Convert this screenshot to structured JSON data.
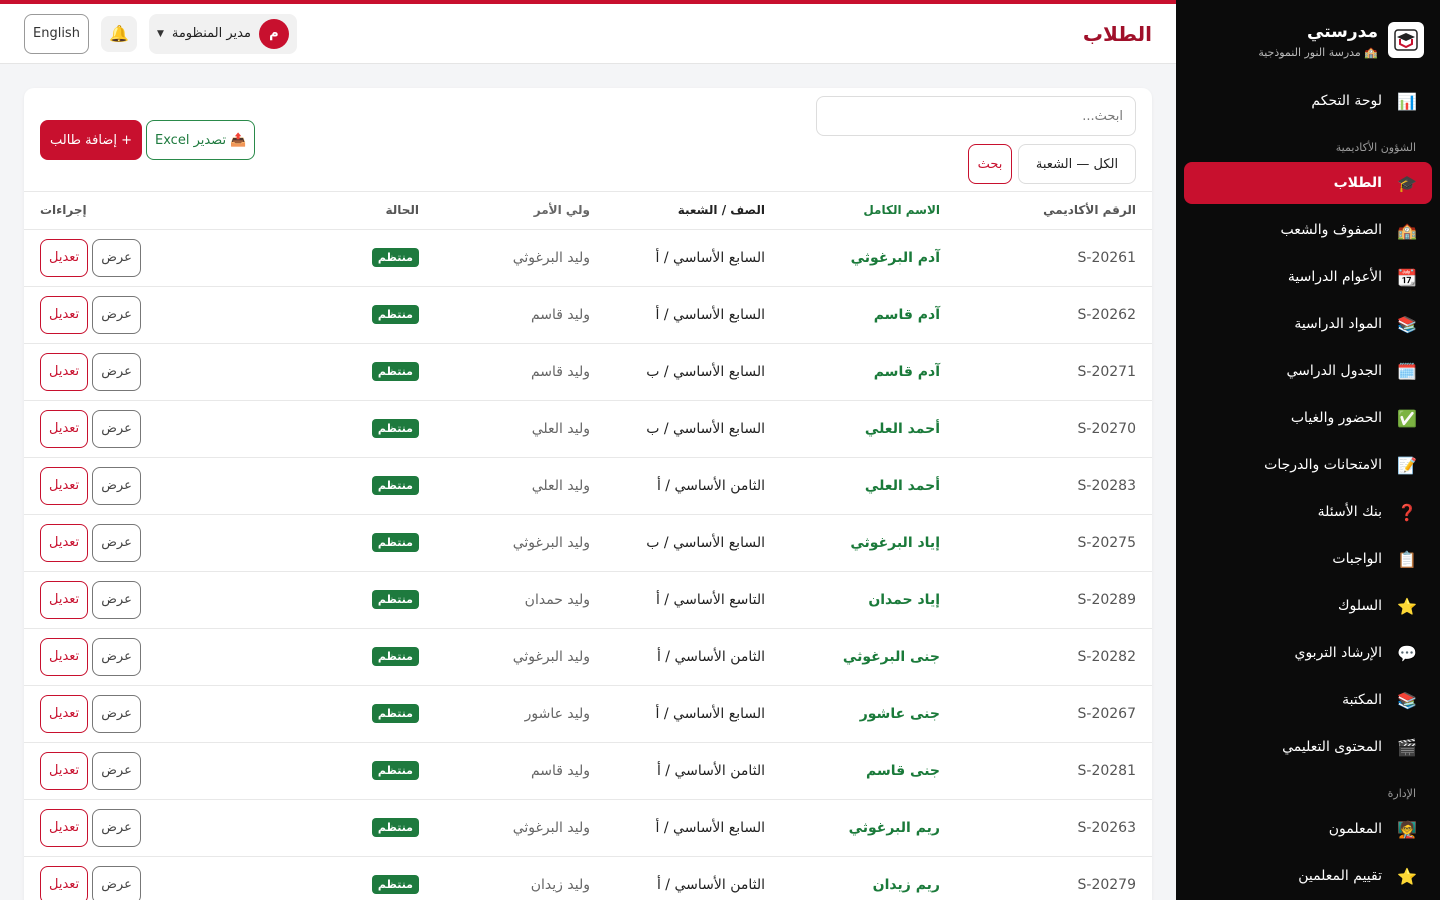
{
  "app": {
    "name": "مدرستي",
    "school": "🏫 مدرسة النور النموذجية"
  },
  "header": {
    "title": "الطلاب",
    "lang_button": "English",
    "user_name": "مدير المنظومة",
    "avatar_letter": "م"
  },
  "sidebar": {
    "top": [
      {
        "label": "لوحة التحكم",
        "icon": "📊"
      }
    ],
    "section1": "الشؤون الأكاديمية",
    "academic": [
      {
        "label": "الطلاب",
        "icon": "🎓",
        "active": true
      },
      {
        "label": "الصفوف والشعب",
        "icon": "🏫"
      },
      {
        "label": "الأعوام الدراسية",
        "icon": "📆"
      },
      {
        "label": "المواد الدراسية",
        "icon": "📚"
      },
      {
        "label": "الجدول الدراسي",
        "icon": "🗓️"
      },
      {
        "label": "الحضور والغياب",
        "icon": "✅"
      },
      {
        "label": "الامتحانات والدرجات",
        "icon": "📝"
      },
      {
        "label": "بنك الأسئلة",
        "icon": "❓"
      },
      {
        "label": "الواجبات",
        "icon": "📋"
      },
      {
        "label": "السلوك",
        "icon": "⭐"
      },
      {
        "label": "الإرشاد التربوي",
        "icon": "💬"
      },
      {
        "label": "المكتبة",
        "icon": "📚"
      },
      {
        "label": "المحتوى التعليمي",
        "icon": "🎬"
      }
    ],
    "section2": "الإدارة",
    "admin": [
      {
        "label": "المعلمون",
        "icon": "🧑‍🏫"
      },
      {
        "label": "تقييم المعلمين",
        "icon": "⭐"
      }
    ]
  },
  "controls": {
    "search_placeholder": "ابحث...",
    "filter_value": "الكل — الشعبة",
    "search_button": "بحث",
    "export_button": "تصدير Excel",
    "export_icon": "📤",
    "add_button": "+ إضافة طالب"
  },
  "table": {
    "headers": {
      "id": "الرقم الأكاديمي",
      "name": "الاسم الكامل",
      "class": "الصف / الشعبة",
      "parent": "ولي الأمر",
      "status": "الحالة",
      "actions": "إجراءات"
    },
    "view_label": "عرض",
    "edit_label": "تعديل",
    "rows": [
      {
        "id": "S-20261",
        "name": "آدم البرغوثي",
        "class": "السابع الأساسي / أ",
        "parent": "وليد البرغوثي",
        "status": "منتظم"
      },
      {
        "id": "S-20262",
        "name": "آدم قاسم",
        "class": "السابع الأساسي / أ",
        "parent": "وليد قاسم",
        "status": "منتظم"
      },
      {
        "id": "S-20271",
        "name": "آدم قاسم",
        "class": "السابع الأساسي / ب",
        "parent": "وليد قاسم",
        "status": "منتظم"
      },
      {
        "id": "S-20270",
        "name": "أحمد العلي",
        "class": "السابع الأساسي / ب",
        "parent": "وليد العلي",
        "status": "منتظم"
      },
      {
        "id": "S-20283",
        "name": "أحمد العلي",
        "class": "الثامن الأساسي / أ",
        "parent": "وليد العلي",
        "status": "منتظم"
      },
      {
        "id": "S-20275",
        "name": "إياد البرغوثي",
        "class": "السابع الأساسي / ب",
        "parent": "وليد البرغوثي",
        "status": "منتظم"
      },
      {
        "id": "S-20289",
        "name": "إياد حمدان",
        "class": "التاسع الأساسي / أ",
        "parent": "وليد حمدان",
        "status": "منتظم"
      },
      {
        "id": "S-20282",
        "name": "جنى البرغوثي",
        "class": "الثامن الأساسي / أ",
        "parent": "وليد البرغوثي",
        "status": "منتظم"
      },
      {
        "id": "S-20267",
        "name": "جنى عاشور",
        "class": "السابع الأساسي / أ",
        "parent": "وليد عاشور",
        "status": "منتظم"
      },
      {
        "id": "S-20281",
        "name": "جنى قاسم",
        "class": "الثامن الأساسي / أ",
        "parent": "وليد قاسم",
        "status": "منتظم"
      },
      {
        "id": "S-20263",
        "name": "ريم البرغوثي",
        "class": "السابع الأساسي / أ",
        "parent": "وليد البرغوثي",
        "status": "منتظم"
      },
      {
        "id": "S-20279",
        "name": "ريم زيدان",
        "class": "الثامن الأساسي / أ",
        "parent": "وليد زيدان",
        "status": "منتظم"
      }
    ]
  }
}
